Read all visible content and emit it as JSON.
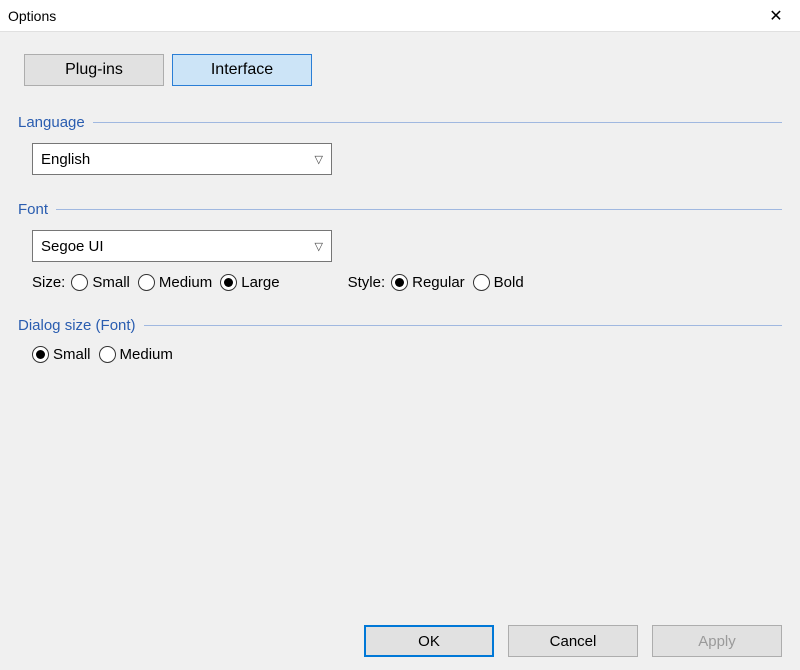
{
  "window": {
    "title": "Options"
  },
  "tabs": {
    "plugins": "Plug-ins",
    "interface": "Interface"
  },
  "groups": {
    "language": {
      "title": "Language",
      "value": "English"
    },
    "font": {
      "title": "Font",
      "value": "Segoe UI",
      "sizeLabel": "Size:",
      "sizeOptions": {
        "small": "Small",
        "medium": "Medium",
        "large": "Large"
      },
      "sizeSelected": "large",
      "styleLabel": "Style:",
      "styleOptions": {
        "regular": "Regular",
        "bold": "Bold"
      },
      "styleSelected": "regular"
    },
    "dialogSize": {
      "title": "Dialog size (Font)",
      "options": {
        "small": "Small",
        "medium": "Medium"
      },
      "selected": "small"
    }
  },
  "buttons": {
    "ok": "OK",
    "cancel": "Cancel",
    "apply": "Apply"
  }
}
